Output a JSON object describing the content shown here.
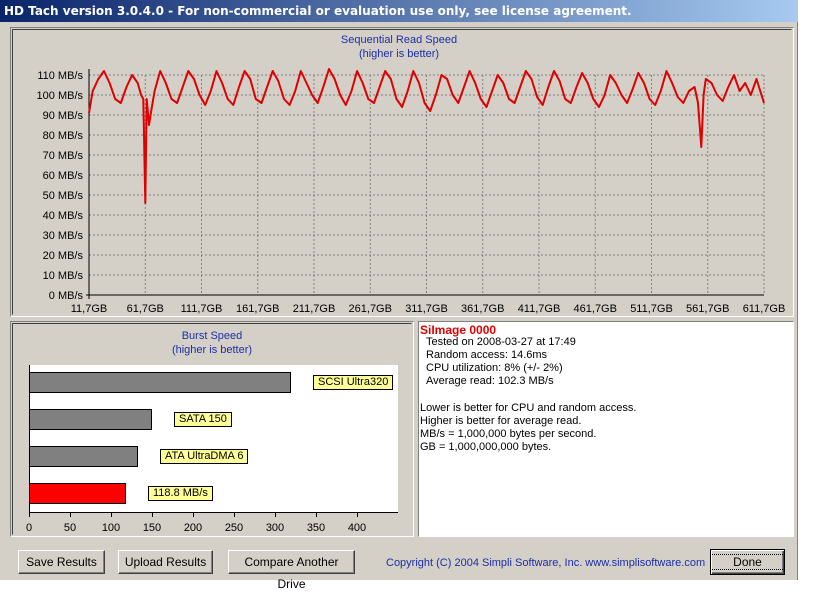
{
  "window": {
    "title": "HD Tach version 3.0.4.0  - For non-commercial or evaluation use only, see license agreement."
  },
  "sequential": {
    "title": "Sequential Read Speed",
    "subtitle": "(higher is better)"
  },
  "burst": {
    "title": "Burst Speed",
    "subtitle": "(higher is better)"
  },
  "info": {
    "drive_name": "SiImage 0000",
    "tested_on": "Tested on 2008-03-27 at 17:49",
    "random_access": "Random access: 14.6ms",
    "cpu_utilization": "CPU utilization: 8% (+/- 2%)",
    "average_read": "Average read: 102.3 MB/s",
    "note1": "Lower is better for CPU and random access.",
    "note2": "Higher is better for average read.",
    "note3": "MB/s = 1,000,000 bytes per second.",
    "note4": "GB = 1,000,000,000 bytes."
  },
  "buttons": {
    "save": "Save Results",
    "upload": "Upload Results",
    "compare": "Compare Another Drive",
    "done": "Done"
  },
  "copyright": "Copyright (C) 2004 Simpli Software, Inc. www.simplisoftware.com",
  "colors": {
    "read_line": "#e00000",
    "burst_bar_current": "#ff0000",
    "burst_bar_reference": "#808080",
    "tag_fill": "#ffff99"
  },
  "chart_data": [
    {
      "type": "line",
      "title": "Sequential Read Speed",
      "subtitle": "(higher is better)",
      "y_unit": "MB/s",
      "ylim": [
        0,
        110
      ],
      "y_ticks": [
        "0 MB/s",
        "10 MB/s",
        "20 MB/s",
        "30 MB/s",
        "40 MB/s",
        "50 MB/s",
        "60 MB/s",
        "70 MB/s",
        "80 MB/s",
        "90 MB/s",
        "100 MB/s",
        "110 MB/s"
      ],
      "x_ticks": [
        "11,7GB",
        "61,7GB",
        "111,7GB",
        "161,7GB",
        "211,7GB",
        "261,7GB",
        "311,7GB",
        "361,7GB",
        "411,7GB",
        "461,7GB",
        "511,7GB",
        "561,7GB",
        "611,7GB"
      ],
      "xlim": [
        11.7,
        611.7
      ],
      "grid": true,
      "x": [
        11.7,
        15,
        20,
        25,
        30,
        35,
        40,
        45,
        50,
        55,
        58,
        60,
        61.7,
        63,
        65,
        67,
        70,
        75,
        80,
        85,
        90,
        95,
        100,
        105,
        110,
        115,
        120,
        125,
        130,
        135,
        140,
        145,
        150,
        155,
        160,
        165,
        170,
        175,
        180,
        185,
        190,
        195,
        200,
        205,
        210,
        215,
        220,
        225,
        230,
        235,
        240,
        245,
        250,
        255,
        260,
        265,
        270,
        275,
        280,
        285,
        290,
        295,
        300,
        305,
        310,
        315,
        320,
        325,
        330,
        335,
        340,
        345,
        350,
        355,
        360,
        365,
        370,
        375,
        380,
        385,
        390,
        395,
        400,
        405,
        410,
        415,
        420,
        425,
        430,
        435,
        440,
        445,
        450,
        455,
        460,
        465,
        470,
        475,
        480,
        485,
        490,
        495,
        500,
        505,
        510,
        515,
        520,
        525,
        530,
        535,
        540,
        545,
        550,
        553,
        556,
        558,
        560,
        565,
        570,
        575,
        580,
        585,
        590,
        595,
        600,
        605,
        611.7
      ],
      "y": [
        91,
        102,
        108,
        112,
        106,
        98,
        96,
        104,
        110,
        106,
        100,
        98,
        46,
        98,
        85,
        92,
        102,
        112,
        106,
        98,
        96,
        104,
        112,
        108,
        100,
        95,
        102,
        112,
        106,
        98,
        95,
        104,
        112,
        108,
        98,
        96,
        104,
        112,
        107,
        98,
        95,
        102,
        112,
        106,
        100,
        96,
        104,
        113,
        108,
        100,
        95,
        102,
        112,
        106,
        98,
        96,
        104,
        112,
        108,
        98,
        94,
        102,
        112,
        106,
        96,
        92,
        100,
        110,
        108,
        100,
        96,
        104,
        112,
        106,
        98,
        94,
        102,
        110,
        106,
        98,
        96,
        104,
        112,
        108,
        99,
        95,
        104,
        112,
        107,
        98,
        96,
        104,
        111,
        106,
        98,
        94,
        100,
        110,
        106,
        100,
        96,
        103,
        111,
        106,
        98,
        95,
        102,
        112,
        106,
        99,
        96,
        102,
        104,
        96,
        74,
        100,
        108,
        106,
        100,
        97,
        104,
        110,
        102,
        106,
        100,
        108,
        96
      ]
    },
    {
      "type": "bar",
      "orientation": "horizontal",
      "title": "Burst Speed",
      "subtitle": "(higher is better)",
      "categories": [
        "SCSI Ultra320",
        "SATA 150",
        "ATA UltraDMA 6",
        "118.8 MB/s"
      ],
      "values": [
        320,
        150,
        133,
        118.8
      ],
      "xlim": [
        0,
        450
      ],
      "x_ticks": [
        "0",
        "50",
        "100",
        "150",
        "200",
        "250",
        "300",
        "350",
        "400"
      ]
    }
  ]
}
